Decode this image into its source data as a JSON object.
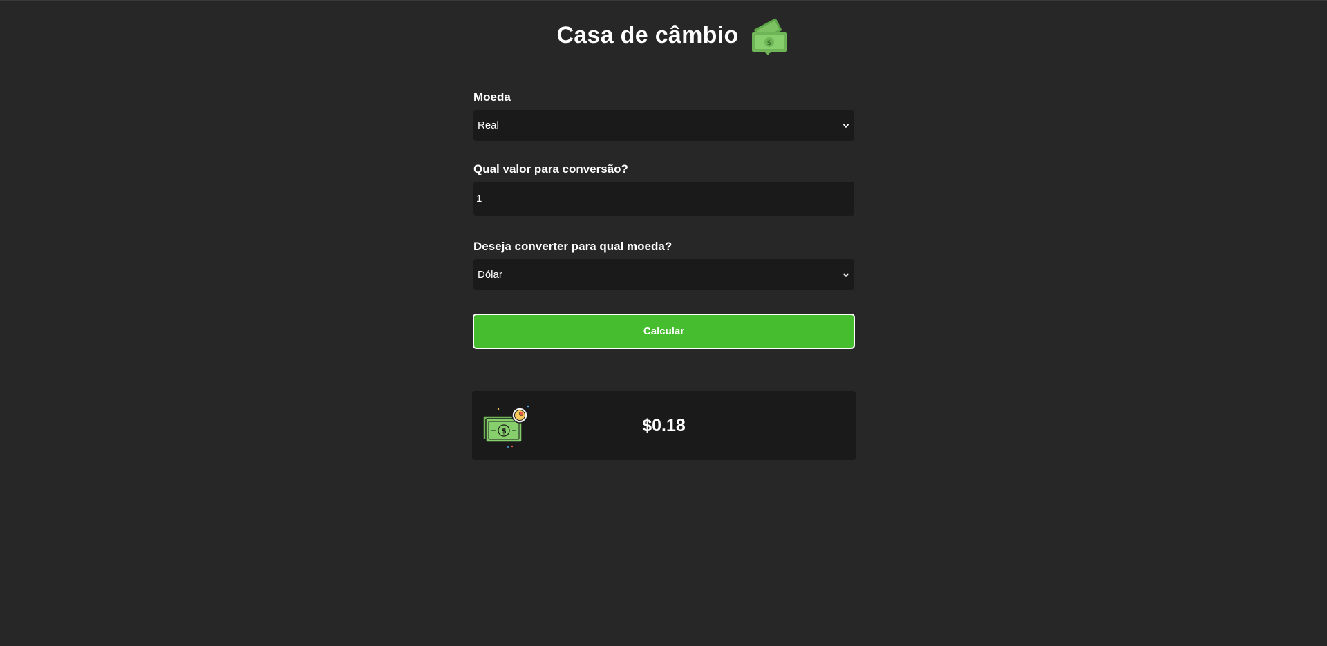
{
  "header": {
    "title": "Casa de câmbio",
    "icon": "money-bills-icon"
  },
  "form": {
    "currency_from": {
      "label": "Moeda",
      "selected": "Real"
    },
    "amount": {
      "label": "Qual valor para conversão?",
      "value": "1"
    },
    "currency_to": {
      "label": "Deseja converter para qual moeda?",
      "selected": "Dólar"
    },
    "submit_label": "Calcular"
  },
  "result": {
    "icon": "money-time-icon",
    "value": "$0.18"
  },
  "colors": {
    "background": "#272727",
    "field_background": "#1a1a1a",
    "accent_green": "#46bd2e"
  }
}
